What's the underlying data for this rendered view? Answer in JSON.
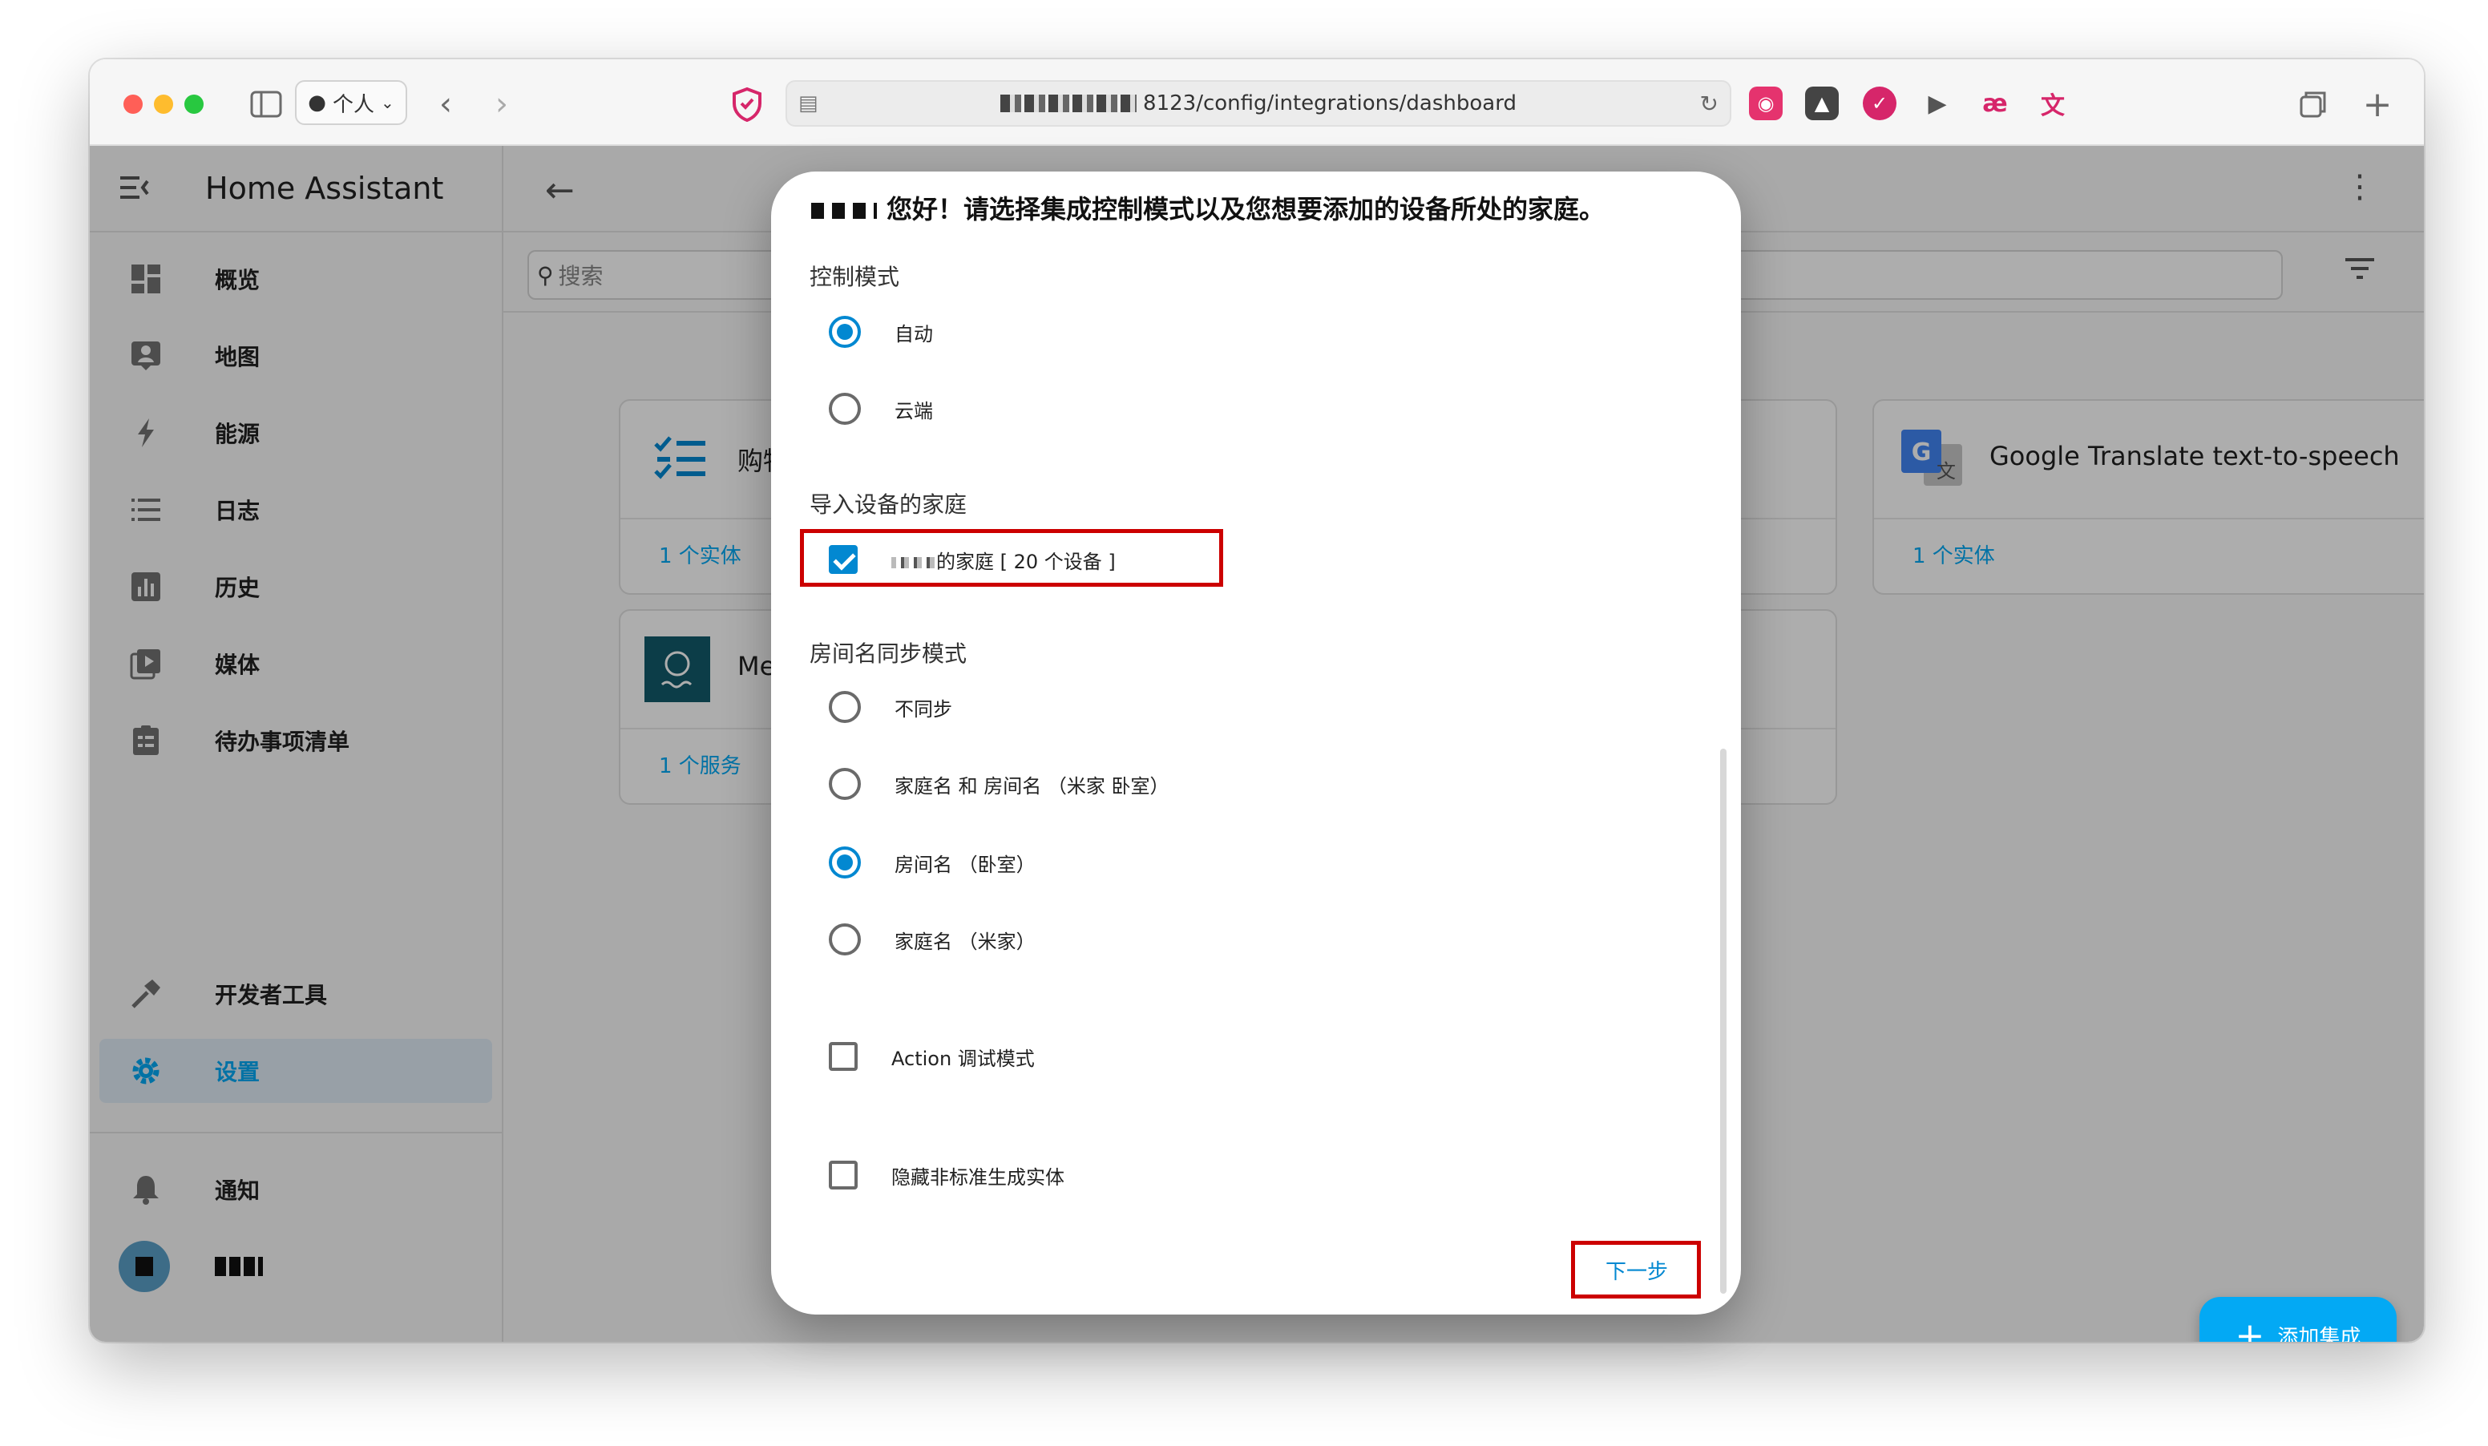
{
  "browser": {
    "profile_label": "个人",
    "url": "8123/config/integrations/dashboard"
  },
  "sidebar": {
    "app_title": "Home Assistant",
    "items": [
      {
        "label": "概览",
        "icon": "dashboard-icon"
      },
      {
        "label": "地图",
        "icon": "map-icon"
      },
      {
        "label": "能源",
        "icon": "lightning-icon"
      },
      {
        "label": "日志",
        "icon": "list-icon"
      },
      {
        "label": "历史",
        "icon": "chart-icon"
      },
      {
        "label": "媒体",
        "icon": "media-icon"
      },
      {
        "label": "待办事项清单",
        "icon": "clipboard-icon"
      }
    ],
    "dev_tools": "开发者工具",
    "settings": "设置",
    "notifications": "通知"
  },
  "main": {
    "search_placeholder": "搜索",
    "cards": [
      {
        "name": "购物清单",
        "count": "1 个实体"
      },
      {
        "name": "Meteorolog",
        "count": "1 个服务"
      },
      {
        "name": "Google Translate text-to-speech",
        "count": "1 个实体"
      }
    ],
    "fab_label": "添加集成"
  },
  "dialog": {
    "title": "您好！请选择集成控制模式以及您想要添加的设备所处的家庭。",
    "control_mode_label": "控制模式",
    "control_modes": [
      {
        "label": "自动",
        "checked": true
      },
      {
        "label": "云端",
        "checked": false
      }
    ],
    "home_label": "导入设备的家庭",
    "home_option": "的家庭 [ 20 个设备 ]",
    "room_sync_label": "房间名同步模式",
    "room_sync_modes": [
      {
        "label": "不同步",
        "checked": false
      },
      {
        "label": "家庭名 和 房间名 （米家 卧室）",
        "checked": false
      },
      {
        "label": "房间名 （卧室）",
        "checked": true
      },
      {
        "label": "家庭名 （米家）",
        "checked": false
      }
    ],
    "action_debug": "Action 调试模式",
    "hide_nonstandard": "隐藏非标准生成实体",
    "next_button": "下一步"
  },
  "colors": {
    "accent": "#03a9f4",
    "highlight_box": "#cc0000"
  }
}
